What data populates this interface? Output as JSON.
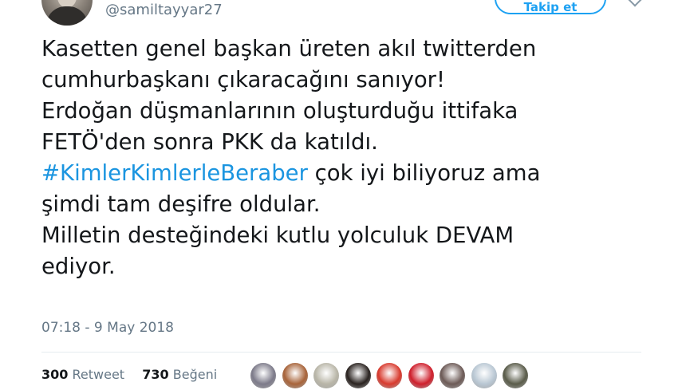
{
  "tweet": {
    "handle": "@samiltayyar27",
    "follow_label": "Takip et",
    "lines": [
      {
        "text": "Kasetten genel başkan üreten akıl twitterden"
      },
      {
        "text": "cumhurbaşkanı çıkaracağını sanıyor!"
      },
      {
        "text": "Erdoğan düşmanlarının oluşturduğu ittifaka"
      },
      {
        "text": "FETÖ'den sonra PKK da katıldı."
      },
      {
        "hashtag": "#KimlerKimlerleBeraber",
        "text": " çok iyi biliyoruz ama"
      },
      {
        "text": "şimdi tam deşifre oldular."
      },
      {
        "text": "Milletin desteğindeki kutlu yolculuk DEVAM"
      },
      {
        "text": "ediyor."
      }
    ],
    "timestamp": "07:18 - 9 May 2018",
    "stats": {
      "retweets": "300",
      "retweets_label": "Retweet",
      "likes": "730",
      "likes_label": "Beğeni"
    }
  },
  "colors": {
    "accent": "#1da1f2",
    "hashtag": "#1b95e0",
    "text": "#14171a",
    "muted": "#657786"
  },
  "likers": [
    {
      "icon": "liker-avatar-1",
      "color": "#7d7b8a"
    },
    {
      "icon": "liker-avatar-2",
      "color": "#a8643a"
    },
    {
      "icon": "liker-avatar-3",
      "color": "#b9b6a8"
    },
    {
      "icon": "liker-avatar-4",
      "color": "#2a2320"
    },
    {
      "icon": "liker-avatar-5",
      "color": "#d83a2e"
    },
    {
      "icon": "liker-avatar-6",
      "color": "#cf1f2c"
    },
    {
      "icon": "liker-avatar-7",
      "color": "#6d5b57"
    },
    {
      "icon": "liker-avatar-8",
      "color": "#b9c7d3"
    },
    {
      "icon": "liker-avatar-9",
      "color": "#5a5c4a"
    }
  ]
}
